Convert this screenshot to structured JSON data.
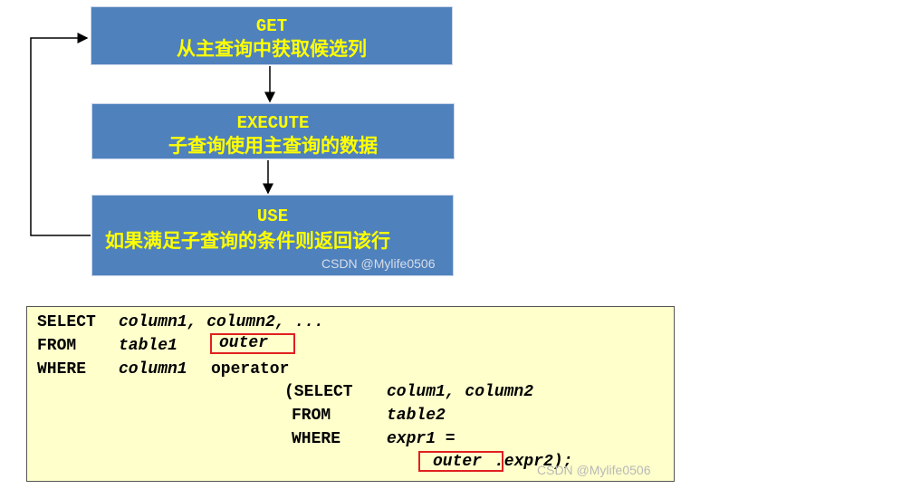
{
  "steps": [
    {
      "keyword": "GET",
      "text": "从主查询中获取候选列"
    },
    {
      "keyword": "EXECUTE",
      "text": "子查询使用主查询的数据"
    },
    {
      "keyword": "USE",
      "text": "如果满足子查询的条件则返回该行"
    }
  ],
  "watermark": "CSDN @Mylife0506",
  "code": {
    "l1_kw": "SELECT",
    "l1_rest": "column1, column2, ...",
    "l2_kw": "FROM",
    "l2_rest": "table1",
    "l2_alias": "outer",
    "l3_kw": "WHERE",
    "l3_rest": "column1",
    "l3_op": "operator",
    "l4_kw": "(SELECT",
    "l4_rest": "colum1, column2",
    "l5_kw": "FROM",
    "l5_rest": "table2",
    "l6_kw": "WHERE",
    "l6_rest": "expr1 =",
    "l7_alias": "outer",
    "l7_rest": ".expr2);"
  },
  "colors": {
    "box_fill": "#4f81bd",
    "box_text": "#ffff00",
    "code_bg": "#ffffcc",
    "highlight": "#e02020"
  }
}
